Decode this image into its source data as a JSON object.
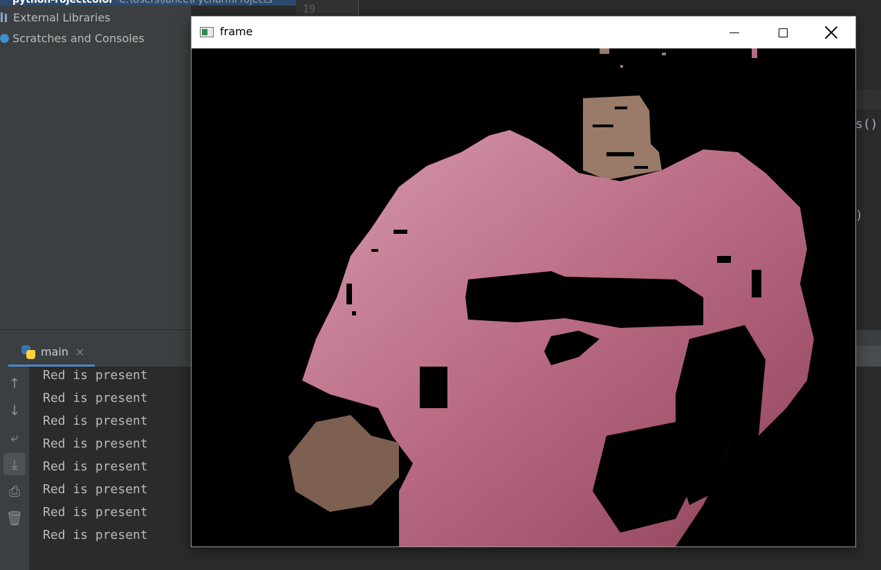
{
  "project": {
    "root_label": "python-rojectcolor",
    "root_path": "C:\\Users\\lance\\PycharmProjects",
    "items": [
      {
        "label": "External Libraries",
        "icon": "library-icon"
      },
      {
        "label": "Scratches and Consoles",
        "icon": "scratches-icon"
      }
    ]
  },
  "editor": {
    "line_number": "19",
    "code_fragments": [
      "s()",
      ")"
    ]
  },
  "run": {
    "tab_label": "main",
    "tab_close": "×",
    "toolbar": [
      {
        "name": "up-arrow-icon",
        "glyph": "↑"
      },
      {
        "name": "down-arrow-icon",
        "glyph": "↓"
      },
      {
        "name": "soft-wrap-icon",
        "glyph": "⤶"
      },
      {
        "name": "scroll-to-end-icon",
        "glyph": "⤓"
      },
      {
        "name": "print-icon",
        "glyph": "⎙"
      },
      {
        "name": "trash-icon",
        "glyph": "🗑"
      }
    ],
    "output_lines": [
      "Red is present",
      "Red is present",
      "Red is present",
      "Red is present",
      "Red is present",
      "Red is present",
      "Red is present",
      "Red is present"
    ]
  },
  "frame_window": {
    "title": "frame",
    "minimize_icon": "minimize-icon",
    "maximize_icon": "maximize-icon",
    "close_icon": "close-icon",
    "shirt_color": "#c8728a",
    "skin_color": "#9a7a68"
  }
}
